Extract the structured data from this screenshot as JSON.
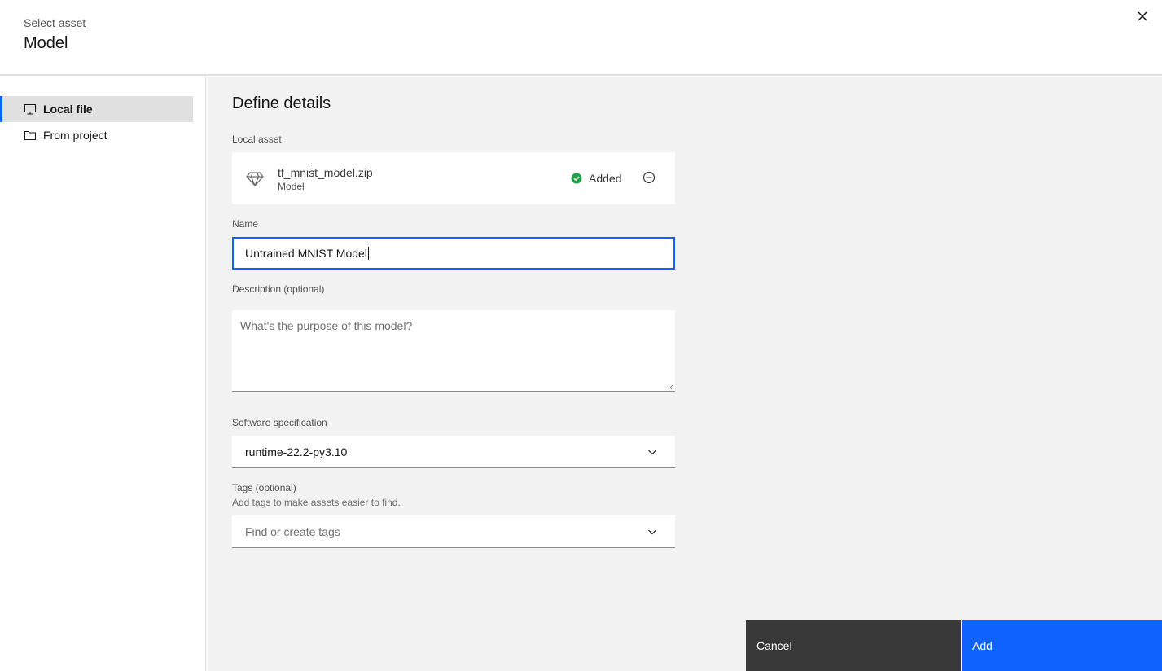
{
  "header": {
    "eyebrow": "Select asset",
    "title": "Model",
    "close_icon": "close-icon"
  },
  "sidebar": {
    "items": [
      {
        "label": "Local file",
        "icon": "desktop-icon",
        "active": true
      },
      {
        "label": "From project",
        "icon": "folder-icon",
        "active": false
      }
    ]
  },
  "main": {
    "section_title": "Define details",
    "local_asset": {
      "label": "Local asset",
      "file_name": "tf_mnist_model.zip",
      "file_type": "Model",
      "status": "Added",
      "status_color": "#24a148"
    },
    "name": {
      "label": "Name",
      "value": "Untrained MNIST Model"
    },
    "description": {
      "label": "Description (optional)",
      "placeholder": "What's the purpose of this model?",
      "value": ""
    },
    "software_spec": {
      "label": "Software specification",
      "selected": "runtime-22.2-py3.10"
    },
    "tags": {
      "label": "Tags (optional)",
      "helper": "Add tags to make assets easier to find.",
      "placeholder": "Find or create tags"
    }
  },
  "footer": {
    "cancel_label": "Cancel",
    "add_label": "Add"
  },
  "colors": {
    "accent": "#0f62fe",
    "secondary_button": "#393939"
  }
}
